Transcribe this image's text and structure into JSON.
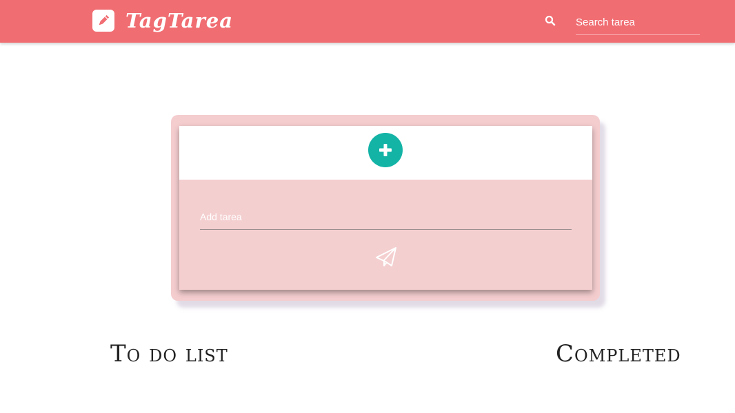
{
  "navbar": {
    "brand_name": "TagTarea",
    "brand_icon": "pencil-icon",
    "search_icon": "search-icon",
    "search_placeholder": "Search tarea",
    "background_color": "#f06d72"
  },
  "card": {
    "add_button_icon": "plus-icon",
    "add_button_color": "#13b3a6",
    "task_placeholder": "Add tarea",
    "send_icon": "paper-plane-icon",
    "body_color": "#f4cfd0"
  },
  "sections": {
    "todo_title": "To do list",
    "completed_title": "Completed"
  }
}
